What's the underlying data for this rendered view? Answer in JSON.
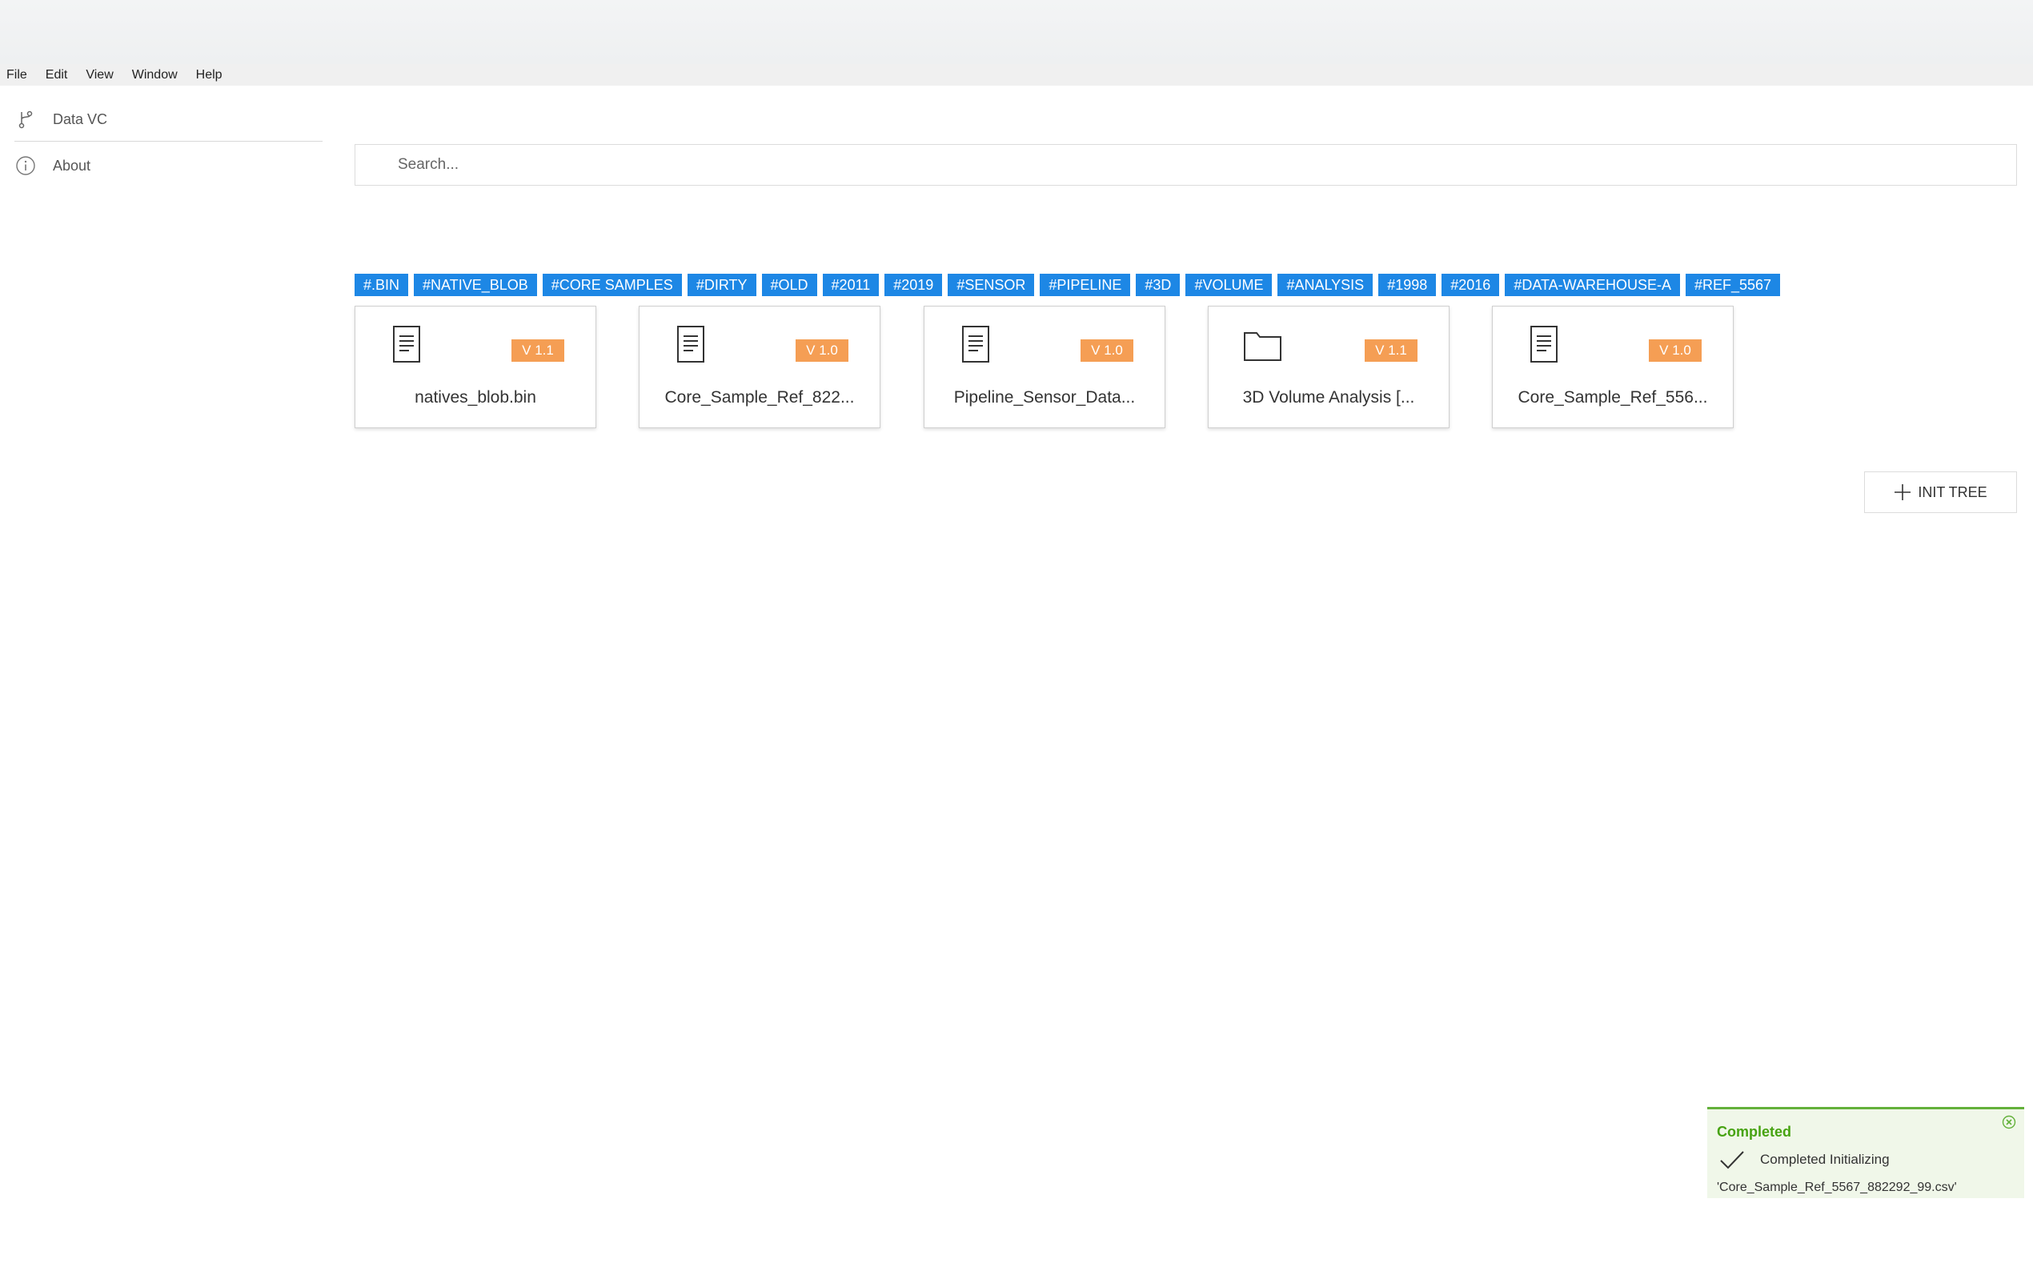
{
  "menubar": {
    "items": [
      "File",
      "Edit",
      "View",
      "Window",
      "Help"
    ]
  },
  "sidebar": {
    "items": [
      {
        "label": "Data VC",
        "icon": "branch-icon"
      },
      {
        "label": "About",
        "icon": "info-icon"
      }
    ]
  },
  "search": {
    "placeholder": "Search..."
  },
  "tags": [
    "#.BIN",
    "#NATIVE_BLOB",
    "#CORE SAMPLES",
    "#DIRTY",
    "#OLD",
    "#2011",
    "#2019",
    "#SENSOR",
    "#PIPELINE",
    "#3D",
    "#VOLUME",
    "#ANALYSIS",
    "#1998",
    "#2016",
    "#DATA-WAREHOUSE-A",
    "#REF_5567"
  ],
  "cards": [
    {
      "name": "natives_blob.bin",
      "version": "V 1.1",
      "icon": "document-icon"
    },
    {
      "name": "Core_Sample_Ref_822...",
      "version": "V 1.0",
      "icon": "document-icon"
    },
    {
      "name": "Pipeline_Sensor_Data...",
      "version": "V 1.0",
      "icon": "document-icon"
    },
    {
      "name": "3D Volume Analysis [...",
      "version": "V 1.1",
      "icon": "folder-icon"
    },
    {
      "name": "Core_Sample_Ref_556...",
      "version": "V 1.0",
      "icon": "document-icon"
    }
  ],
  "init_button": {
    "label": "INIT TREE",
    "icon": "plus-icon"
  },
  "toast": {
    "title": "Completed",
    "message": "Completed Initializing",
    "file": "'Core_Sample_Ref_5567_882292_99.csv'",
    "icons": [
      "check-icon",
      "close-icon"
    ]
  },
  "colors": {
    "tag": "#1d87e5",
    "badge": "#f59e54",
    "toast_accent": "#63b13a",
    "toast_bg": "#f0f7e9"
  }
}
